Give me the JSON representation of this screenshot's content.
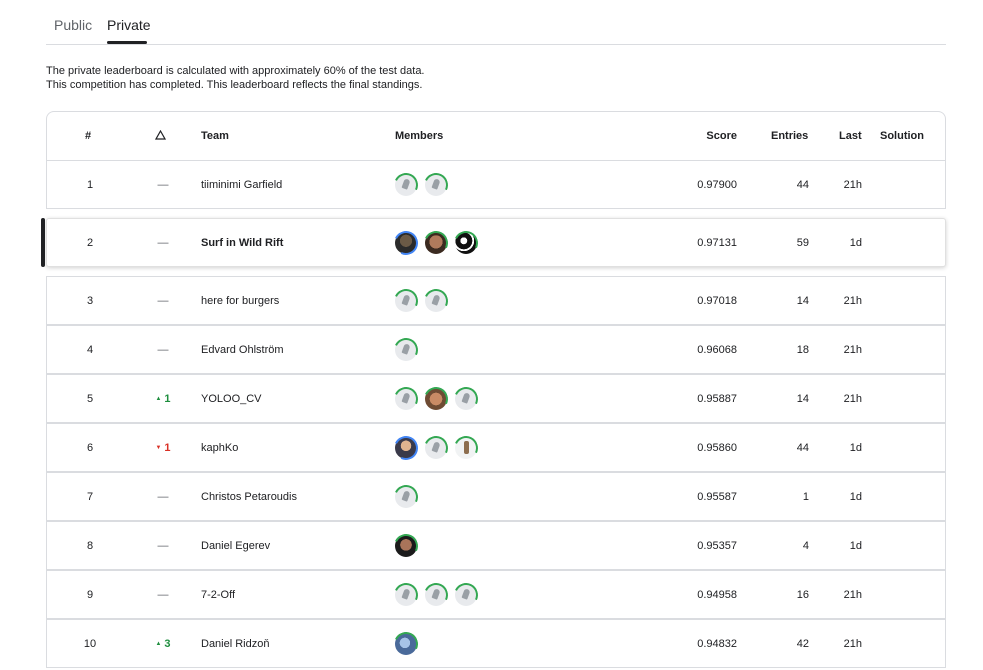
{
  "tabs": {
    "public": "Public",
    "private": "Private"
  },
  "notes": {
    "line1": "The private leaderboard is calculated with approximately 60% of the test data.",
    "line2": "This competition has completed. This leaderboard reflects the final standings."
  },
  "columns": {
    "rank": "#",
    "delta_icon": "triangle-icon",
    "team": "Team",
    "members": "Members",
    "score": "Score",
    "entries": "Entries",
    "last": "Last",
    "solution": "Solution"
  },
  "rows": [
    {
      "rank": "1",
      "delta": "—",
      "team": "tiiminimi Garfield",
      "score": "0.97900",
      "entries": "44",
      "last": "21h"
    },
    {
      "rank": "2",
      "delta": "—",
      "team": "Surf in Wild Rift",
      "score": "0.97131",
      "entries": "59",
      "last": "1d"
    },
    {
      "rank": "3",
      "delta": "—",
      "team": "here for burgers",
      "score": "0.97018",
      "entries": "14",
      "last": "21h"
    },
    {
      "rank": "4",
      "delta": "—",
      "team": "Edvard Ohlström",
      "score": "0.96068",
      "entries": "18",
      "last": "21h"
    },
    {
      "rank": "5",
      "delta": "1",
      "team": "YOLOO_CV",
      "score": "0.95887",
      "entries": "14",
      "last": "21h"
    },
    {
      "rank": "6",
      "delta": "1",
      "team": "kaphKo",
      "score": "0.95860",
      "entries": "44",
      "last": "1d"
    },
    {
      "rank": "7",
      "delta": "—",
      "team": "Christos Petaroudis",
      "score": "0.95587",
      "entries": "1",
      "last": "1d"
    },
    {
      "rank": "8",
      "delta": "—",
      "team": "Daniel Egerev",
      "score": "0.95357",
      "entries": "4",
      "last": "1d"
    },
    {
      "rank": "9",
      "delta": "—",
      "team": "7-2-Off",
      "score": "0.94958",
      "entries": "16",
      "last": "21h"
    },
    {
      "rank": "10",
      "delta": "3",
      "team": "Daniel Ridzoň",
      "score": "0.94832",
      "entries": "42",
      "last": "21h"
    }
  ],
  "colors": {
    "up": "#1e8e3e",
    "down": "#d93025",
    "progress_ring": "#34a853"
  }
}
